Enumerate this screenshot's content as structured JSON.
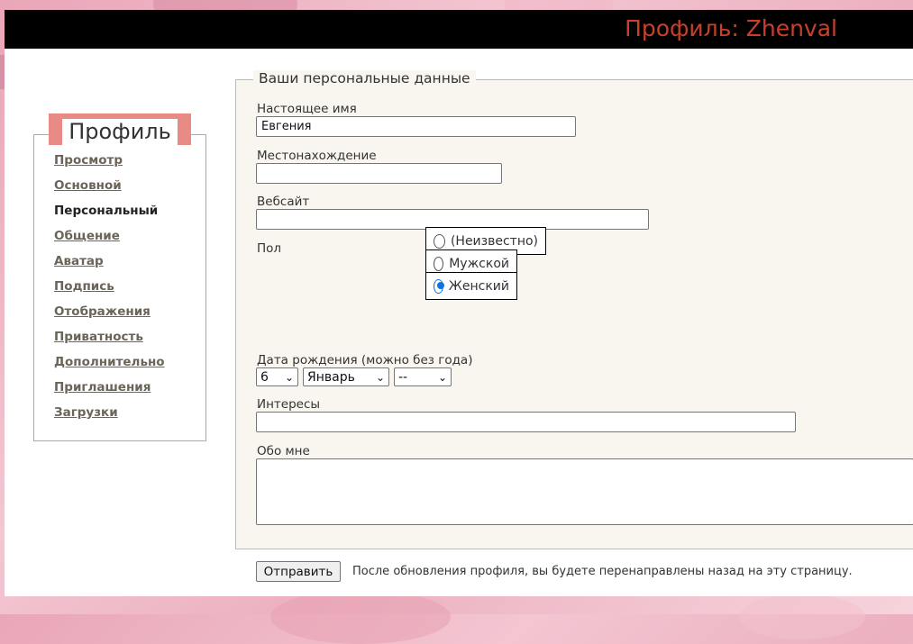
{
  "header": {
    "title": "Профиль: Zhenval"
  },
  "sidebar": {
    "title": "Профиль",
    "items": [
      {
        "label": "Просмотр"
      },
      {
        "label": "Основной"
      },
      {
        "label": "Персональный",
        "current": true
      },
      {
        "label": "Общение"
      },
      {
        "label": "Аватар"
      },
      {
        "label": "Подпись"
      },
      {
        "label": "Отображения"
      },
      {
        "label": "Приватность"
      },
      {
        "label": "Дополнительно"
      },
      {
        "label": "Приглашения"
      },
      {
        "label": "Загрузки"
      }
    ]
  },
  "form": {
    "legend": "Ваши персональные данные",
    "real_name": {
      "label": "Настоящее имя",
      "value": "Евгения"
    },
    "location": {
      "label": "Местонахождение",
      "value": ""
    },
    "website": {
      "label": "Вебсайт",
      "value": ""
    },
    "gender": {
      "label": "Пол",
      "options": [
        {
          "label": "(Неизвестно)",
          "checked": false
        },
        {
          "label": "Мужской",
          "checked": false
        },
        {
          "label": "Женский",
          "checked": true
        }
      ]
    },
    "birthday": {
      "label": "Дата рождения (можно без года)",
      "day": "6",
      "month": "Январь",
      "year": "--"
    },
    "interests": {
      "label": "Интересы",
      "value": ""
    },
    "about": {
      "label": "Обо мне",
      "value": ""
    },
    "submit_label": "Отправить",
    "note": "После обновления профиля, вы будете перенаправлены назад на эту страницу."
  },
  "colors": {
    "topbar": "#000000",
    "title": "#c8402a",
    "sidebar_accent": "#e88a86",
    "fieldset_bg": "#f8f6ee",
    "radio_checked": "#0a74e6"
  }
}
